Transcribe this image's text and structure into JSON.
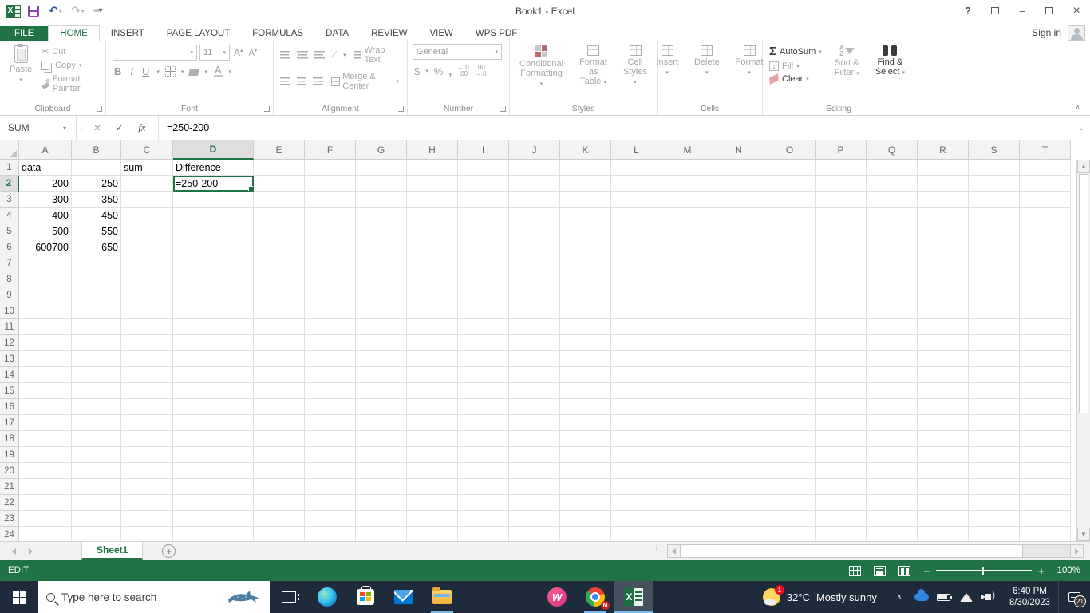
{
  "window": {
    "title": "Book1 - Excel",
    "sign_in": "Sign in"
  },
  "titlebar_icons": {
    "help": "?",
    "minimize": "–",
    "close": "×"
  },
  "ribbon_tabs": [
    "FILE",
    "HOME",
    "INSERT",
    "PAGE LAYOUT",
    "FORMULAS",
    "DATA",
    "REVIEW",
    "VIEW",
    "WPS PDF"
  ],
  "active_tab": "HOME",
  "ribbon": {
    "clipboard": {
      "label": "Clipboard",
      "paste": "Paste",
      "cut": "Cut",
      "copy": "Copy",
      "format_painter": "Format Painter"
    },
    "font": {
      "label": "Font",
      "size": "11",
      "bold": "B",
      "italic": "I",
      "underline": "U",
      "grow": "A",
      "shrink": "A",
      "color": "A"
    },
    "alignment": {
      "label": "Alignment",
      "wrap_text": "Wrap Text",
      "merge_center": "Merge & Center"
    },
    "number": {
      "label": "Number",
      "format": "General",
      "currency": "$",
      "percent": "%",
      "comma": ",",
      "inc1": "←.0",
      "inc2": ".00",
      "dec1": ".00",
      "dec2": "→.0"
    },
    "styles": {
      "label": "Styles",
      "cond1": "Conditional",
      "cond2": "Formatting",
      "table1": "Format as",
      "table2": "Table",
      "cellst1": "Cell",
      "cellst2": "Styles"
    },
    "cells": {
      "label": "Cells",
      "insert": "Insert",
      "delete": "Delete",
      "format": "Format"
    },
    "editing": {
      "label": "Editing",
      "autosum": "AutoSum",
      "autosum_icon": "Σ",
      "fill": "Fill",
      "fill_icon": "↓",
      "clear": "Clear",
      "sort1": "Sort &",
      "sort2": "Filter",
      "find1": "Find &",
      "find2": "Select"
    }
  },
  "formula_bar": {
    "name_box": "SUM",
    "cancel": "×",
    "enter": "✓",
    "fx": "fx",
    "formula": "=250-200"
  },
  "grid": {
    "columns": [
      "A",
      "B",
      "C",
      "D",
      "E",
      "F",
      "G",
      "H",
      "I",
      "J",
      "K",
      "L",
      "M",
      "N",
      "O",
      "P",
      "Q",
      "R",
      "S",
      "T"
    ],
    "selected_column": "D",
    "row_count": 24,
    "selected_row": 2,
    "editing_cell": "D2",
    "cells": {
      "A1": "data",
      "C1": "sum",
      "D1": "Difference",
      "A2": "200",
      "B2": "250",
      "D2": "=250-200",
      "A3": "300",
      "B3": "350",
      "A4": "400",
      "B4": "450",
      "A5": "500",
      "B5": "550",
      "A6": "600700",
      "B6": "650"
    },
    "right_aligned": [
      "A2",
      "B2",
      "A3",
      "B3",
      "A4",
      "B4",
      "A5",
      "B5",
      "A6",
      "B6"
    ]
  },
  "sheet_bar": {
    "active_tab": "Sheet1",
    "add": "+"
  },
  "status_bar": {
    "mode": "EDIT",
    "zoom": "100%"
  },
  "taskbar": {
    "search_placeholder": "Type here to search",
    "wps_letter": "W",
    "excel_letter": "X",
    "chrome_badge": "M",
    "weather_badge": "1",
    "weather_temp": "32°C",
    "weather_desc": "Mostly sunny",
    "time": "6:40 PM",
    "date": "8/30/2023",
    "notification_count": "21"
  },
  "colors": {
    "excel_green": "#217346",
    "taskbar": "#1d2b3a",
    "accent_blue": "#76b9ed"
  }
}
